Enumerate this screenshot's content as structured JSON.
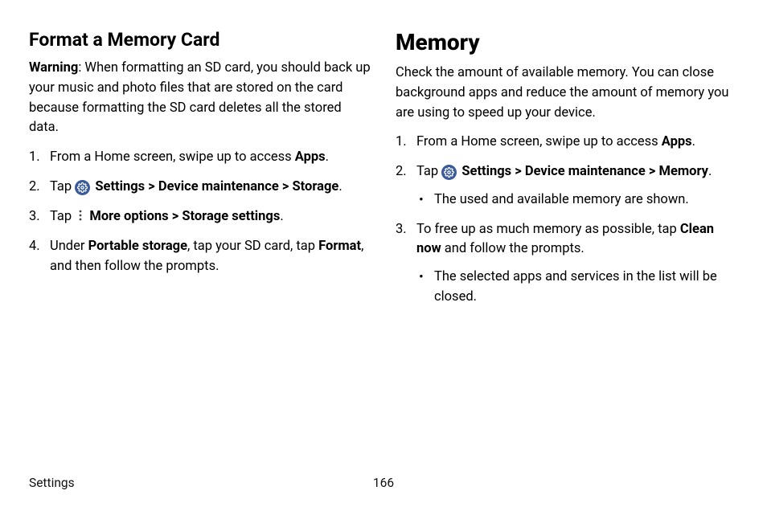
{
  "left": {
    "heading": "Format a Memory Card",
    "warning_label": "Warning",
    "warning_text": ": When formatting an SD card, you should back up your music and photo files that are stored on the card because formatting the SD card deletes all the stored data.",
    "step1_a": "From a Home screen, swipe up to access ",
    "step1_b": "Apps",
    "step1_c": ".",
    "step2_a": "Tap ",
    "step2_b": "Settings",
    "step2_c": " > ",
    "step2_d": "Device maintenance",
    "step2_e": " > ",
    "step2_f": "Storage",
    "step2_g": ".",
    "step3_a": "Tap ",
    "step3_b": "More options",
    "step3_c": " > ",
    "step3_d": "Storage settings",
    "step3_e": ".",
    "step4_a": "Under ",
    "step4_b": "Portable storage",
    "step4_c": ", tap your SD card, tap ",
    "step4_d": "Format",
    "step4_e": ", and then follow the prompts."
  },
  "right": {
    "heading": "Memory",
    "intro": "Check the amount of available memory. You can close background apps and reduce the amount of memory you are using to speed up your device.",
    "step1_a": "From a Home screen, swipe up to access ",
    "step1_b": "Apps",
    "step1_c": ".",
    "step2_a": "Tap ",
    "step2_b": "Settings",
    "step2_c": " > ",
    "step2_d": "Device maintenance",
    "step2_e": " > ",
    "step2_f": "Memory",
    "step2_g": ".",
    "step2_sub": "The used and available memory are shown.",
    "step3_a": "To free up as much memory as possible, tap ",
    "step3_b": "Clean now",
    "step3_c": " and follow the prompts.",
    "step3_sub": "The selected apps and services in the list will be closed."
  },
  "footer": {
    "section": "Settings",
    "page": "166"
  }
}
